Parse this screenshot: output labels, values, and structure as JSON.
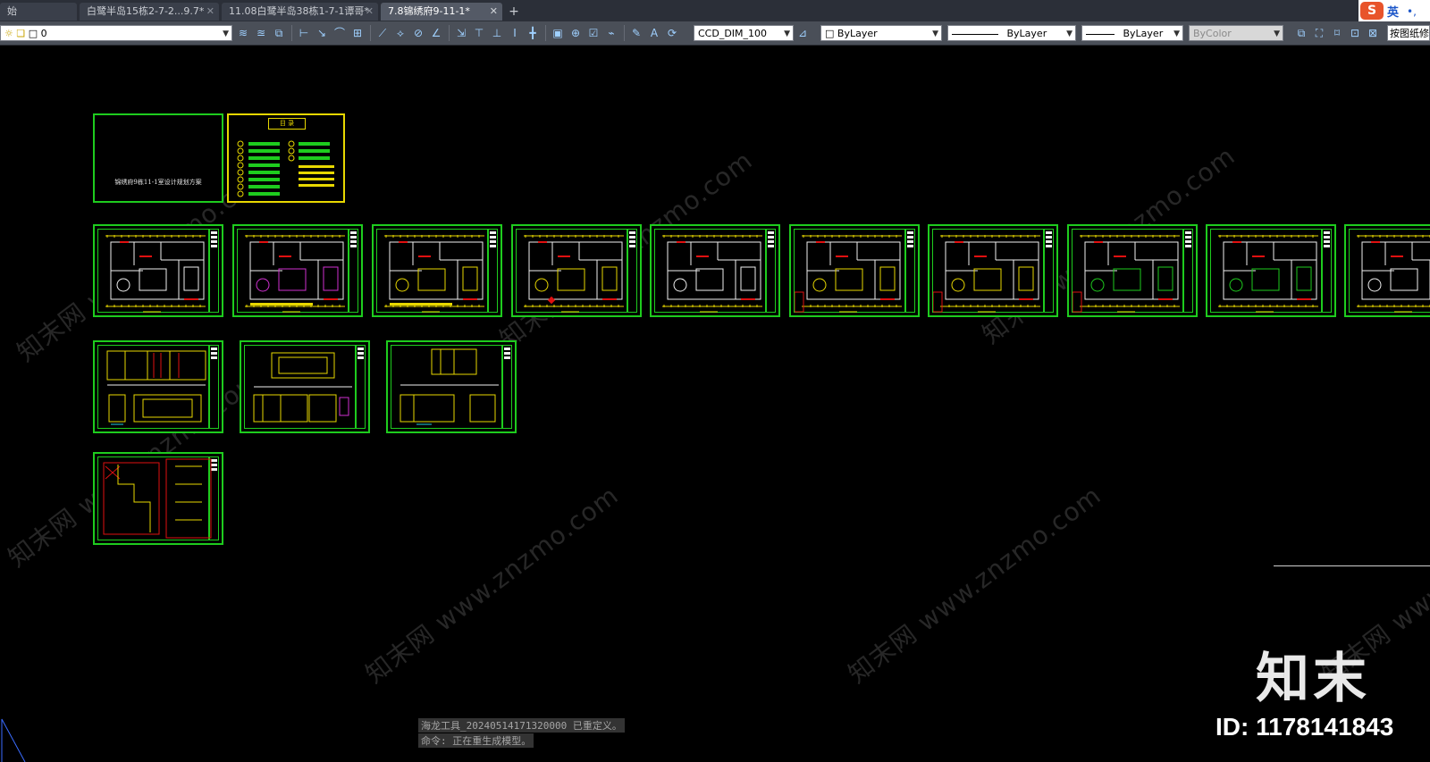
{
  "tabs": [
    {
      "label": "始",
      "active": false
    },
    {
      "label": "白鹭半岛15栋2-7-2...9.7*",
      "active": false
    },
    {
      "label": "11.08白鹭半岛38栋1-7-1谭哥*",
      "active": false
    },
    {
      "label": "7.8锦绣府9-11-1*",
      "active": true
    }
  ],
  "ime": {
    "language": "英"
  },
  "toolbar": {
    "layer_value": "0",
    "dimstyle_value": "CCD_DIM_100",
    "layer_combo": "ByLayer",
    "linetype_combo": "ByLayer",
    "lineweight_combo": "ByLayer",
    "plotstyle_combo": "ByColor",
    "right_button": "按图纸修"
  },
  "canvas": {
    "cover_title": "锦绣府9栋11-1室设计规划方案",
    "index_title": "目  录",
    "watermark_text": "知末网 www.znzmo.com",
    "brand": "知末",
    "id_label": "ID: 1178141843",
    "command_lines": [
      "海龙工具_20240514171320000 已重定义。",
      "命令: 正在重生成模型。"
    ]
  },
  "colors": {
    "sheet_border": "#1ecc1e",
    "wall": "#f0f0f0",
    "dim": "#ffe600",
    "red": "#e01010",
    "magenta": "#d030d0",
    "cyan": "#20d0e0"
  }
}
